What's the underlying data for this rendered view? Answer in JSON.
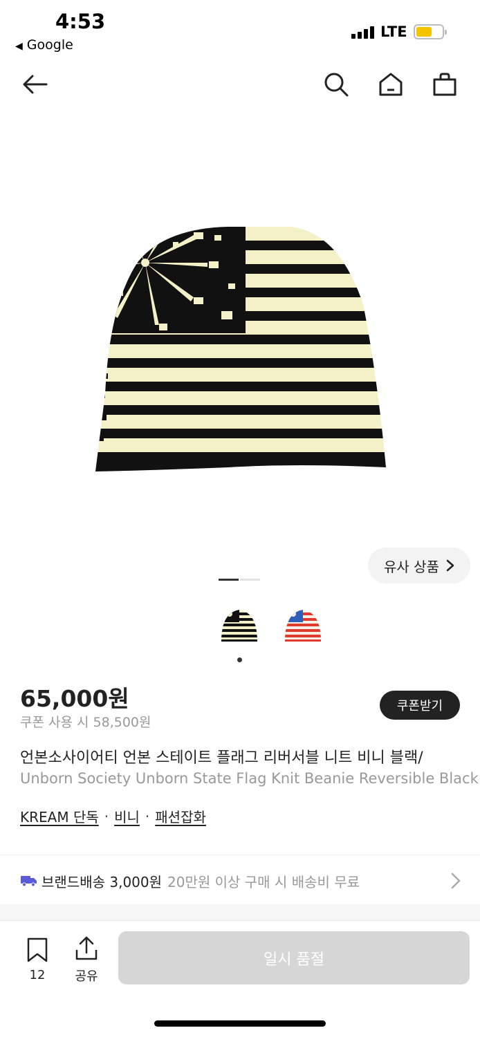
{
  "status_bar": {
    "time": "4:53",
    "back_app": "Google",
    "network": "LTE",
    "battery_color": "#f5c400"
  },
  "nav": {
    "back_icon": "arrow-left-icon",
    "search_icon": "search-icon",
    "home_icon": "home-icon",
    "cart_icon": "shopping-bag-icon"
  },
  "gallery": {
    "similar_label": "유사 상품",
    "pager": {
      "current": 1,
      "total": 2
    },
    "thumbnails": [
      "black-cream-flag-beanie",
      "red-blue-flag-beanie"
    ],
    "selected_thumbnail": 1
  },
  "product": {
    "price": "65,000원",
    "coupon_price": "쿠폰 사용 시 58,500원",
    "coupon_button": "쿠폰받기",
    "title_ko": "언본소사이어티 언본 스테이트 플래그 리버서블 니트 비니 블랙/",
    "title_en": "Unborn Society Unborn State Flag Knit Beanie Reversible Black",
    "tags": [
      "KREAM 단독",
      "비니",
      "패션잡화"
    ],
    "tag_separator": "·"
  },
  "shipping": {
    "label": "브랜드배송 3,000원",
    "note": "20만원 이상 구매 시 배송비 무료",
    "icon": "truck-icon",
    "icon_color": "#5b5bd6"
  },
  "bottom_bar": {
    "bookmark_count": "12",
    "share_label": "공유",
    "buy_button": "일시 품절"
  }
}
